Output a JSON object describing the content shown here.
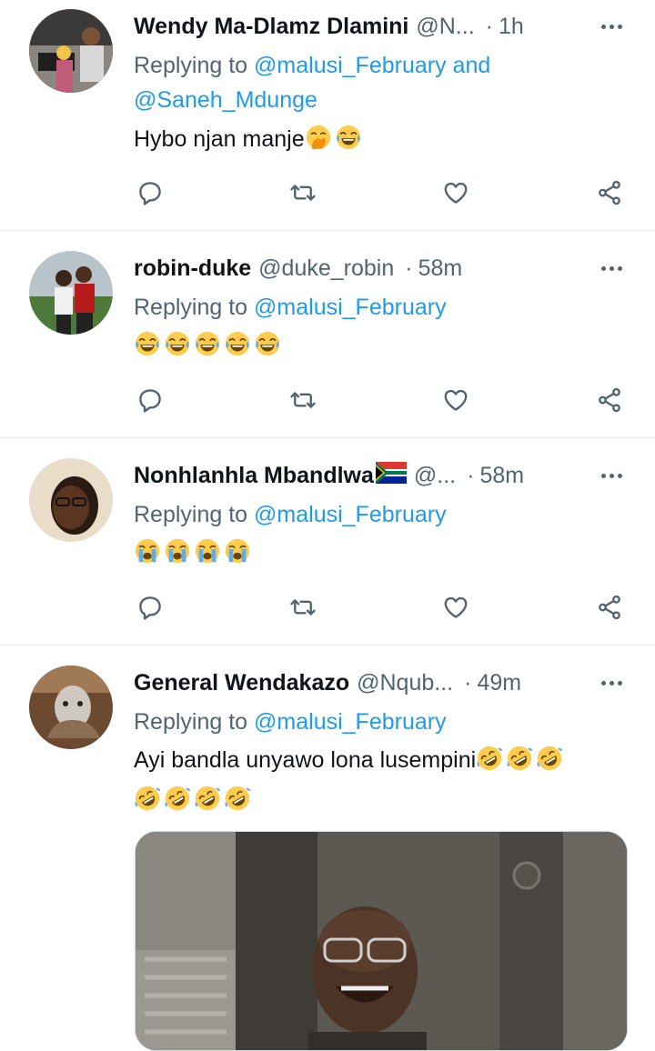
{
  "tweets": [
    {
      "name": "Wendy Ma-Dlamz Dlamini",
      "handle": "@N...",
      "separator": "·",
      "time": "1h",
      "replying_prefix": "Replying to ",
      "replying_mentions": "@malusi_February and @Saneh_Mdunge",
      "text": "Hybo njan manje",
      "emojis": [
        "face-with-hand-over-mouth",
        "face-with-tears-of-joy"
      ]
    },
    {
      "name": "robin-duke",
      "handle": "@duke_robin",
      "separator": "·",
      "time": "58m",
      "replying_prefix": "Replying to ",
      "replying_mentions": "@malusi_February",
      "text": "",
      "emojis": [
        "face-with-tears-of-joy",
        "face-with-tears-of-joy",
        "face-with-tears-of-joy",
        "face-with-tears-of-joy",
        "face-with-tears-of-joy"
      ]
    },
    {
      "name": "Nonhlanhla Mbandlwa",
      "name_flag": "south-africa-flag",
      "handle": "@...",
      "separator": "·",
      "time": "58m",
      "replying_prefix": "Replying to ",
      "replying_mentions": "@malusi_February",
      "text": "",
      "emojis": [
        "loudly-crying-face",
        "loudly-crying-face",
        "loudly-crying-face",
        "loudly-crying-face"
      ]
    },
    {
      "name": "General Wendakazo",
      "handle": "@Nqub...",
      "separator": "·",
      "time": "49m",
      "replying_prefix": "Replying to ",
      "replying_mentions": "@malusi_February",
      "text": "Ayi bandla unyawo lona lusempini",
      "emojis": [
        "rolling-on-floor-laughing",
        "rolling-on-floor-laughing",
        "rolling-on-floor-laughing"
      ],
      "emojis_line2": [
        "rolling-on-floor-laughing",
        "rolling-on-floor-laughing",
        "rolling-on-floor-laughing",
        "rolling-on-floor-laughing"
      ]
    }
  ],
  "actions": [
    "reply-icon",
    "retweet-icon",
    "like-icon",
    "share-icon"
  ],
  "colors": {
    "link": "#1d9bf0",
    "secondary_text": "#536471",
    "primary_text": "#0f1419",
    "divider": "#e6ecf0"
  }
}
